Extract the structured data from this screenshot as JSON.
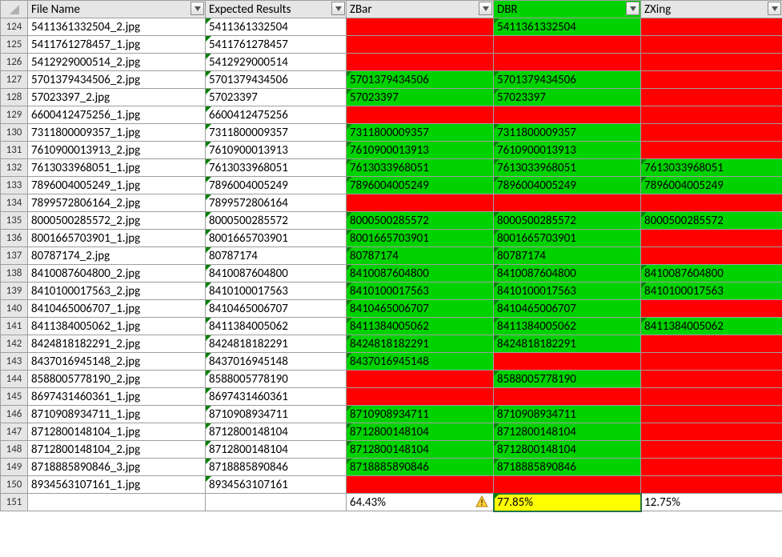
{
  "headers": {
    "col_a": "File Name",
    "col_b": "Expected Results",
    "col_c": "ZBar",
    "col_d": "DBR",
    "col_e": "ZXing"
  },
  "rows": [
    {
      "num": "124",
      "fname": "5411361332504_2.jpg",
      "exp": "5411361332504",
      "zbar": {
        "v": "",
        "bg": "red"
      },
      "dbr": {
        "v": "5411361332504",
        "bg": "green"
      },
      "zxing": {
        "v": "",
        "bg": "red"
      }
    },
    {
      "num": "125",
      "fname": "5411761278457_1.jpg",
      "exp": "5411761278457",
      "zbar": {
        "v": "",
        "bg": "red"
      },
      "dbr": {
        "v": "",
        "bg": "red"
      },
      "zxing": {
        "v": "",
        "bg": "red"
      }
    },
    {
      "num": "126",
      "fname": "5412929000514_2.jpg",
      "exp": "5412929000514",
      "zbar": {
        "v": "",
        "bg": "red"
      },
      "dbr": {
        "v": "",
        "bg": "red"
      },
      "zxing": {
        "v": "",
        "bg": "red"
      }
    },
    {
      "num": "127",
      "fname": "5701379434506_2.jpg",
      "exp": "5701379434506",
      "zbar": {
        "v": "5701379434506",
        "bg": "green"
      },
      "dbr": {
        "v": "5701379434506",
        "bg": "green"
      },
      "zxing": {
        "v": "",
        "bg": "red"
      }
    },
    {
      "num": "128",
      "fname": "57023397_2.jpg",
      "exp": "57023397",
      "zbar": {
        "v": "57023397",
        "bg": "green"
      },
      "dbr": {
        "v": "57023397",
        "bg": "green"
      },
      "zxing": {
        "v": "",
        "bg": "red"
      }
    },
    {
      "num": "129",
      "fname": "6600412475256_1.jpg",
      "exp": "6600412475256",
      "zbar": {
        "v": "",
        "bg": "red"
      },
      "dbr": {
        "v": "",
        "bg": "red"
      },
      "zxing": {
        "v": "",
        "bg": "red"
      }
    },
    {
      "num": "130",
      "fname": "7311800009357_1.jpg",
      "exp": "7311800009357",
      "zbar": {
        "v": "7311800009357",
        "bg": "green"
      },
      "dbr": {
        "v": "7311800009357",
        "bg": "green"
      },
      "zxing": {
        "v": "",
        "bg": "red"
      }
    },
    {
      "num": "131",
      "fname": "7610900013913_2.jpg",
      "exp": "7610900013913",
      "zbar": {
        "v": "7610900013913",
        "bg": "green"
      },
      "dbr": {
        "v": "7610900013913",
        "bg": "green"
      },
      "zxing": {
        "v": "",
        "bg": "red"
      }
    },
    {
      "num": "132",
      "fname": "7613033968051_1.jpg",
      "exp": "7613033968051",
      "zbar": {
        "v": "7613033968051",
        "bg": "green"
      },
      "dbr": {
        "v": "7613033968051",
        "bg": "green"
      },
      "zxing": {
        "v": "7613033968051",
        "bg": "green"
      }
    },
    {
      "num": "133",
      "fname": "7896004005249_1.jpg",
      "exp": "7896004005249",
      "zbar": {
        "v": "7896004005249",
        "bg": "green"
      },
      "dbr": {
        "v": "7896004005249",
        "bg": "green"
      },
      "zxing": {
        "v": "7896004005249",
        "bg": "green"
      }
    },
    {
      "num": "134",
      "fname": "7899572806164_2.jpg",
      "exp": "7899572806164",
      "zbar": {
        "v": "",
        "bg": "red"
      },
      "dbr": {
        "v": "",
        "bg": "red"
      },
      "zxing": {
        "v": "",
        "bg": "red"
      }
    },
    {
      "num": "135",
      "fname": "8000500285572_2.jpg",
      "exp": "8000500285572",
      "zbar": {
        "v": "8000500285572",
        "bg": "green"
      },
      "dbr": {
        "v": "8000500285572",
        "bg": "green"
      },
      "zxing": {
        "v": "8000500285572",
        "bg": "green"
      }
    },
    {
      "num": "136",
      "fname": "8001665703901_1.jpg",
      "exp": "8001665703901",
      "zbar": {
        "v": "8001665703901",
        "bg": "green"
      },
      "dbr": {
        "v": "8001665703901",
        "bg": "green"
      },
      "zxing": {
        "v": "",
        "bg": "red"
      }
    },
    {
      "num": "137",
      "fname": "80787174_2.jpg",
      "exp": "80787174",
      "zbar": {
        "v": "80787174",
        "bg": "green"
      },
      "dbr": {
        "v": "80787174",
        "bg": "green"
      },
      "zxing": {
        "v": "",
        "bg": "red"
      }
    },
    {
      "num": "138",
      "fname": "8410087604800_2.jpg",
      "exp": "8410087604800",
      "zbar": {
        "v": "8410087604800",
        "bg": "green"
      },
      "dbr": {
        "v": "8410087604800",
        "bg": "green"
      },
      "zxing": {
        "v": "8410087604800",
        "bg": "green"
      }
    },
    {
      "num": "139",
      "fname": "8410100017563_2.jpg",
      "exp": "8410100017563",
      "zbar": {
        "v": "8410100017563",
        "bg": "green"
      },
      "dbr": {
        "v": "8410100017563",
        "bg": "green"
      },
      "zxing": {
        "v": "8410100017563",
        "bg": "green"
      }
    },
    {
      "num": "140",
      "fname": "8410465006707_1.jpg",
      "exp": "8410465006707",
      "zbar": {
        "v": "8410465006707",
        "bg": "green"
      },
      "dbr": {
        "v": "8410465006707",
        "bg": "green"
      },
      "zxing": {
        "v": "",
        "bg": "red"
      }
    },
    {
      "num": "141",
      "fname": "8411384005062_1.jpg",
      "exp": "8411384005062",
      "zbar": {
        "v": "8411384005062",
        "bg": "green"
      },
      "dbr": {
        "v": "8411384005062",
        "bg": "green"
      },
      "zxing": {
        "v": "8411384005062",
        "bg": "green"
      }
    },
    {
      "num": "142",
      "fname": "8424818182291_2.jpg",
      "exp": "8424818182291",
      "zbar": {
        "v": "8424818182291",
        "bg": "green"
      },
      "dbr": {
        "v": "8424818182291",
        "bg": "green"
      },
      "zxing": {
        "v": "",
        "bg": "red"
      }
    },
    {
      "num": "143",
      "fname": "8437016945148_2.jpg",
      "exp": "8437016945148",
      "zbar": {
        "v": "8437016945148",
        "bg": "green"
      },
      "dbr": {
        "v": "",
        "bg": "red"
      },
      "zxing": {
        "v": "",
        "bg": "red"
      }
    },
    {
      "num": "144",
      "fname": "8588005778190_2.jpg",
      "exp": "8588005778190",
      "zbar": {
        "v": "",
        "bg": "red"
      },
      "dbr": {
        "v": "8588005778190",
        "bg": "green"
      },
      "zxing": {
        "v": "",
        "bg": "red"
      }
    },
    {
      "num": "145",
      "fname": "8697431460361_1.jpg",
      "exp": "8697431460361",
      "zbar": {
        "v": "",
        "bg": "red"
      },
      "dbr": {
        "v": "",
        "bg": "red"
      },
      "zxing": {
        "v": "",
        "bg": "red"
      }
    },
    {
      "num": "146",
      "fname": "8710908934711_1.jpg",
      "exp": "8710908934711",
      "zbar": {
        "v": "8710908934711",
        "bg": "green"
      },
      "dbr": {
        "v": "8710908934711",
        "bg": "green"
      },
      "zxing": {
        "v": "",
        "bg": "red"
      }
    },
    {
      "num": "147",
      "fname": "8712800148104_1.jpg",
      "exp": "8712800148104",
      "zbar": {
        "v": "8712800148104",
        "bg": "green"
      },
      "dbr": {
        "v": "8712800148104",
        "bg": "green"
      },
      "zxing": {
        "v": "",
        "bg": "red"
      }
    },
    {
      "num": "148",
      "fname": "8712800148104_2.jpg",
      "exp": "8712800148104",
      "zbar": {
        "v": "8712800148104",
        "bg": "green"
      },
      "dbr": {
        "v": "8712800148104",
        "bg": "green"
      },
      "zxing": {
        "v": "",
        "bg": "red"
      }
    },
    {
      "num": "149",
      "fname": "8718885890846_3.jpg",
      "exp": "8718885890846",
      "zbar": {
        "v": "8718885890846",
        "bg": "green"
      },
      "dbr": {
        "v": "8718885890846",
        "bg": "green"
      },
      "zxing": {
        "v": "",
        "bg": "red"
      }
    },
    {
      "num": "150",
      "fname": "8934563107161_1.jpg",
      "exp": "8934563107161",
      "zbar": {
        "v": "",
        "bg": "red"
      },
      "dbr": {
        "v": "",
        "bg": "red"
      },
      "zxing": {
        "v": "",
        "bg": "red"
      }
    }
  ],
  "summary": {
    "row_num": "151",
    "zbar": {
      "v": "64.43%",
      "warn": true
    },
    "dbr": {
      "v": "77.85%",
      "bg": "yellow",
      "selected": true
    },
    "zxing": {
      "v": "12.75%"
    }
  }
}
